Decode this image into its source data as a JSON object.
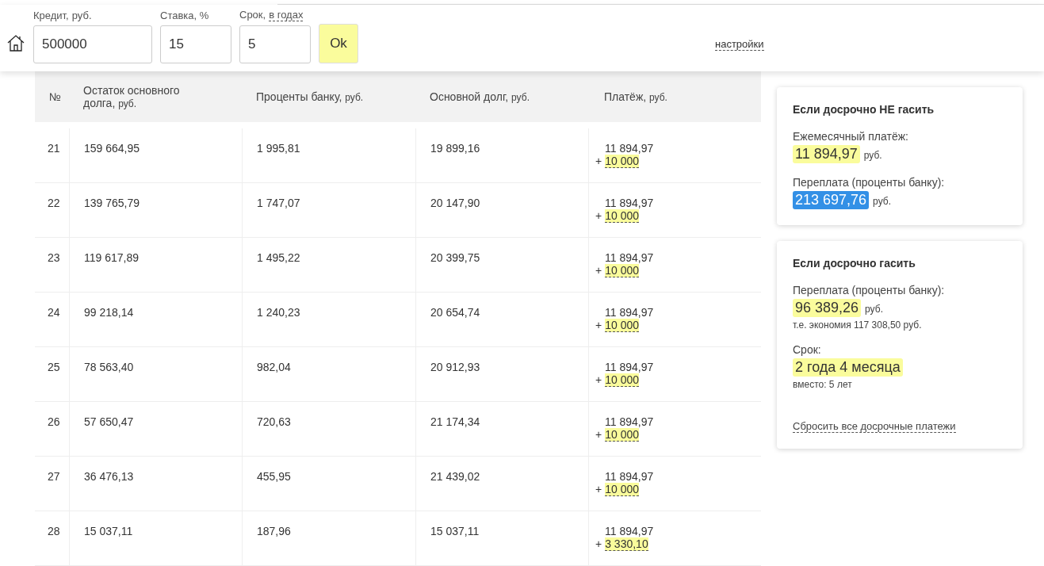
{
  "toolbar": {
    "fields": [
      {
        "label": "Кредит,",
        "unit": "руб.",
        "value": "500000",
        "wide": true
      },
      {
        "label": "Ставка, %",
        "value": "15",
        "wide": false
      },
      {
        "label": "Срок,",
        "link": "в годах",
        "value": "5",
        "wide": false
      }
    ],
    "ok_button": "Ok",
    "settings_link": "настройки"
  },
  "table": {
    "columns": [
      {
        "label": "№"
      },
      {
        "label": "Остаток основного долга,",
        "unit": "руб."
      },
      {
        "label": "Проценты банку,",
        "unit": "руб."
      },
      {
        "label": "Основной долг,",
        "unit": "руб."
      },
      {
        "label": "Платёж,",
        "unit": "руб."
      }
    ],
    "rows": [
      {
        "n": "21",
        "balance": "159 664,95",
        "interest": "1 995,81",
        "principal": "19 899,16",
        "payment": "11 894,97",
        "sign": "+",
        "extra": "10 000"
      },
      {
        "n": "22",
        "balance": "139 765,79",
        "interest": "1 747,07",
        "principal": "20 147,90",
        "payment": "11 894,97",
        "sign": "+",
        "extra": "10 000"
      },
      {
        "n": "23",
        "balance": "119 617,89",
        "interest": "1 495,22",
        "principal": "20 399,75",
        "payment": "11 894,97",
        "sign": "+",
        "extra": "10 000"
      },
      {
        "n": "24",
        "balance": "99 218,14",
        "interest": "1 240,23",
        "principal": "20 654,74",
        "payment": "11 894,97",
        "sign": "+",
        "extra": "10 000"
      },
      {
        "n": "25",
        "balance": "78 563,40",
        "interest": "982,04",
        "principal": "20 912,93",
        "payment": "11 894,97",
        "sign": "+",
        "extra": "10 000"
      },
      {
        "n": "26",
        "balance": "57 650,47",
        "interest": "720,63",
        "principal": "21 174,34",
        "payment": "11 894,97",
        "sign": "+",
        "extra": "10 000"
      },
      {
        "n": "27",
        "balance": "36 476,13",
        "interest": "455,95",
        "principal": "21 439,02",
        "payment": "11 894,97",
        "sign": "+",
        "extra": "10 000"
      },
      {
        "n": "28",
        "balance": "15 037,11",
        "interest": "187,96",
        "principal": "15 037,11",
        "payment": "11 894,97",
        "sign": "+",
        "extra": "3 330,10"
      }
    ]
  },
  "cards": [
    {
      "title": "Если досрочно НЕ гасить",
      "items": [
        {
          "label": "Ежемесячный платёж:",
          "value": "11 894,97",
          "unit": "руб.",
          "selected": false
        },
        {
          "label": "Переплата (проценты банку):",
          "value": "213 697,76",
          "unit": "руб.",
          "selected": true
        }
      ]
    },
    {
      "title": "Если досрочно гасить",
      "items": [
        {
          "label": "Переплата (проценты банку):",
          "value": "96 389,26",
          "unit": "руб.",
          "note": "т.е. экономия 117 308,50 руб.",
          "selected": false
        },
        {
          "label": "Срок:",
          "value": "2 года 4 месяца",
          "note": "вместо: 5 лет",
          "selected": false
        }
      ],
      "link": "Сбросить все досрочные платежи"
    }
  ]
}
